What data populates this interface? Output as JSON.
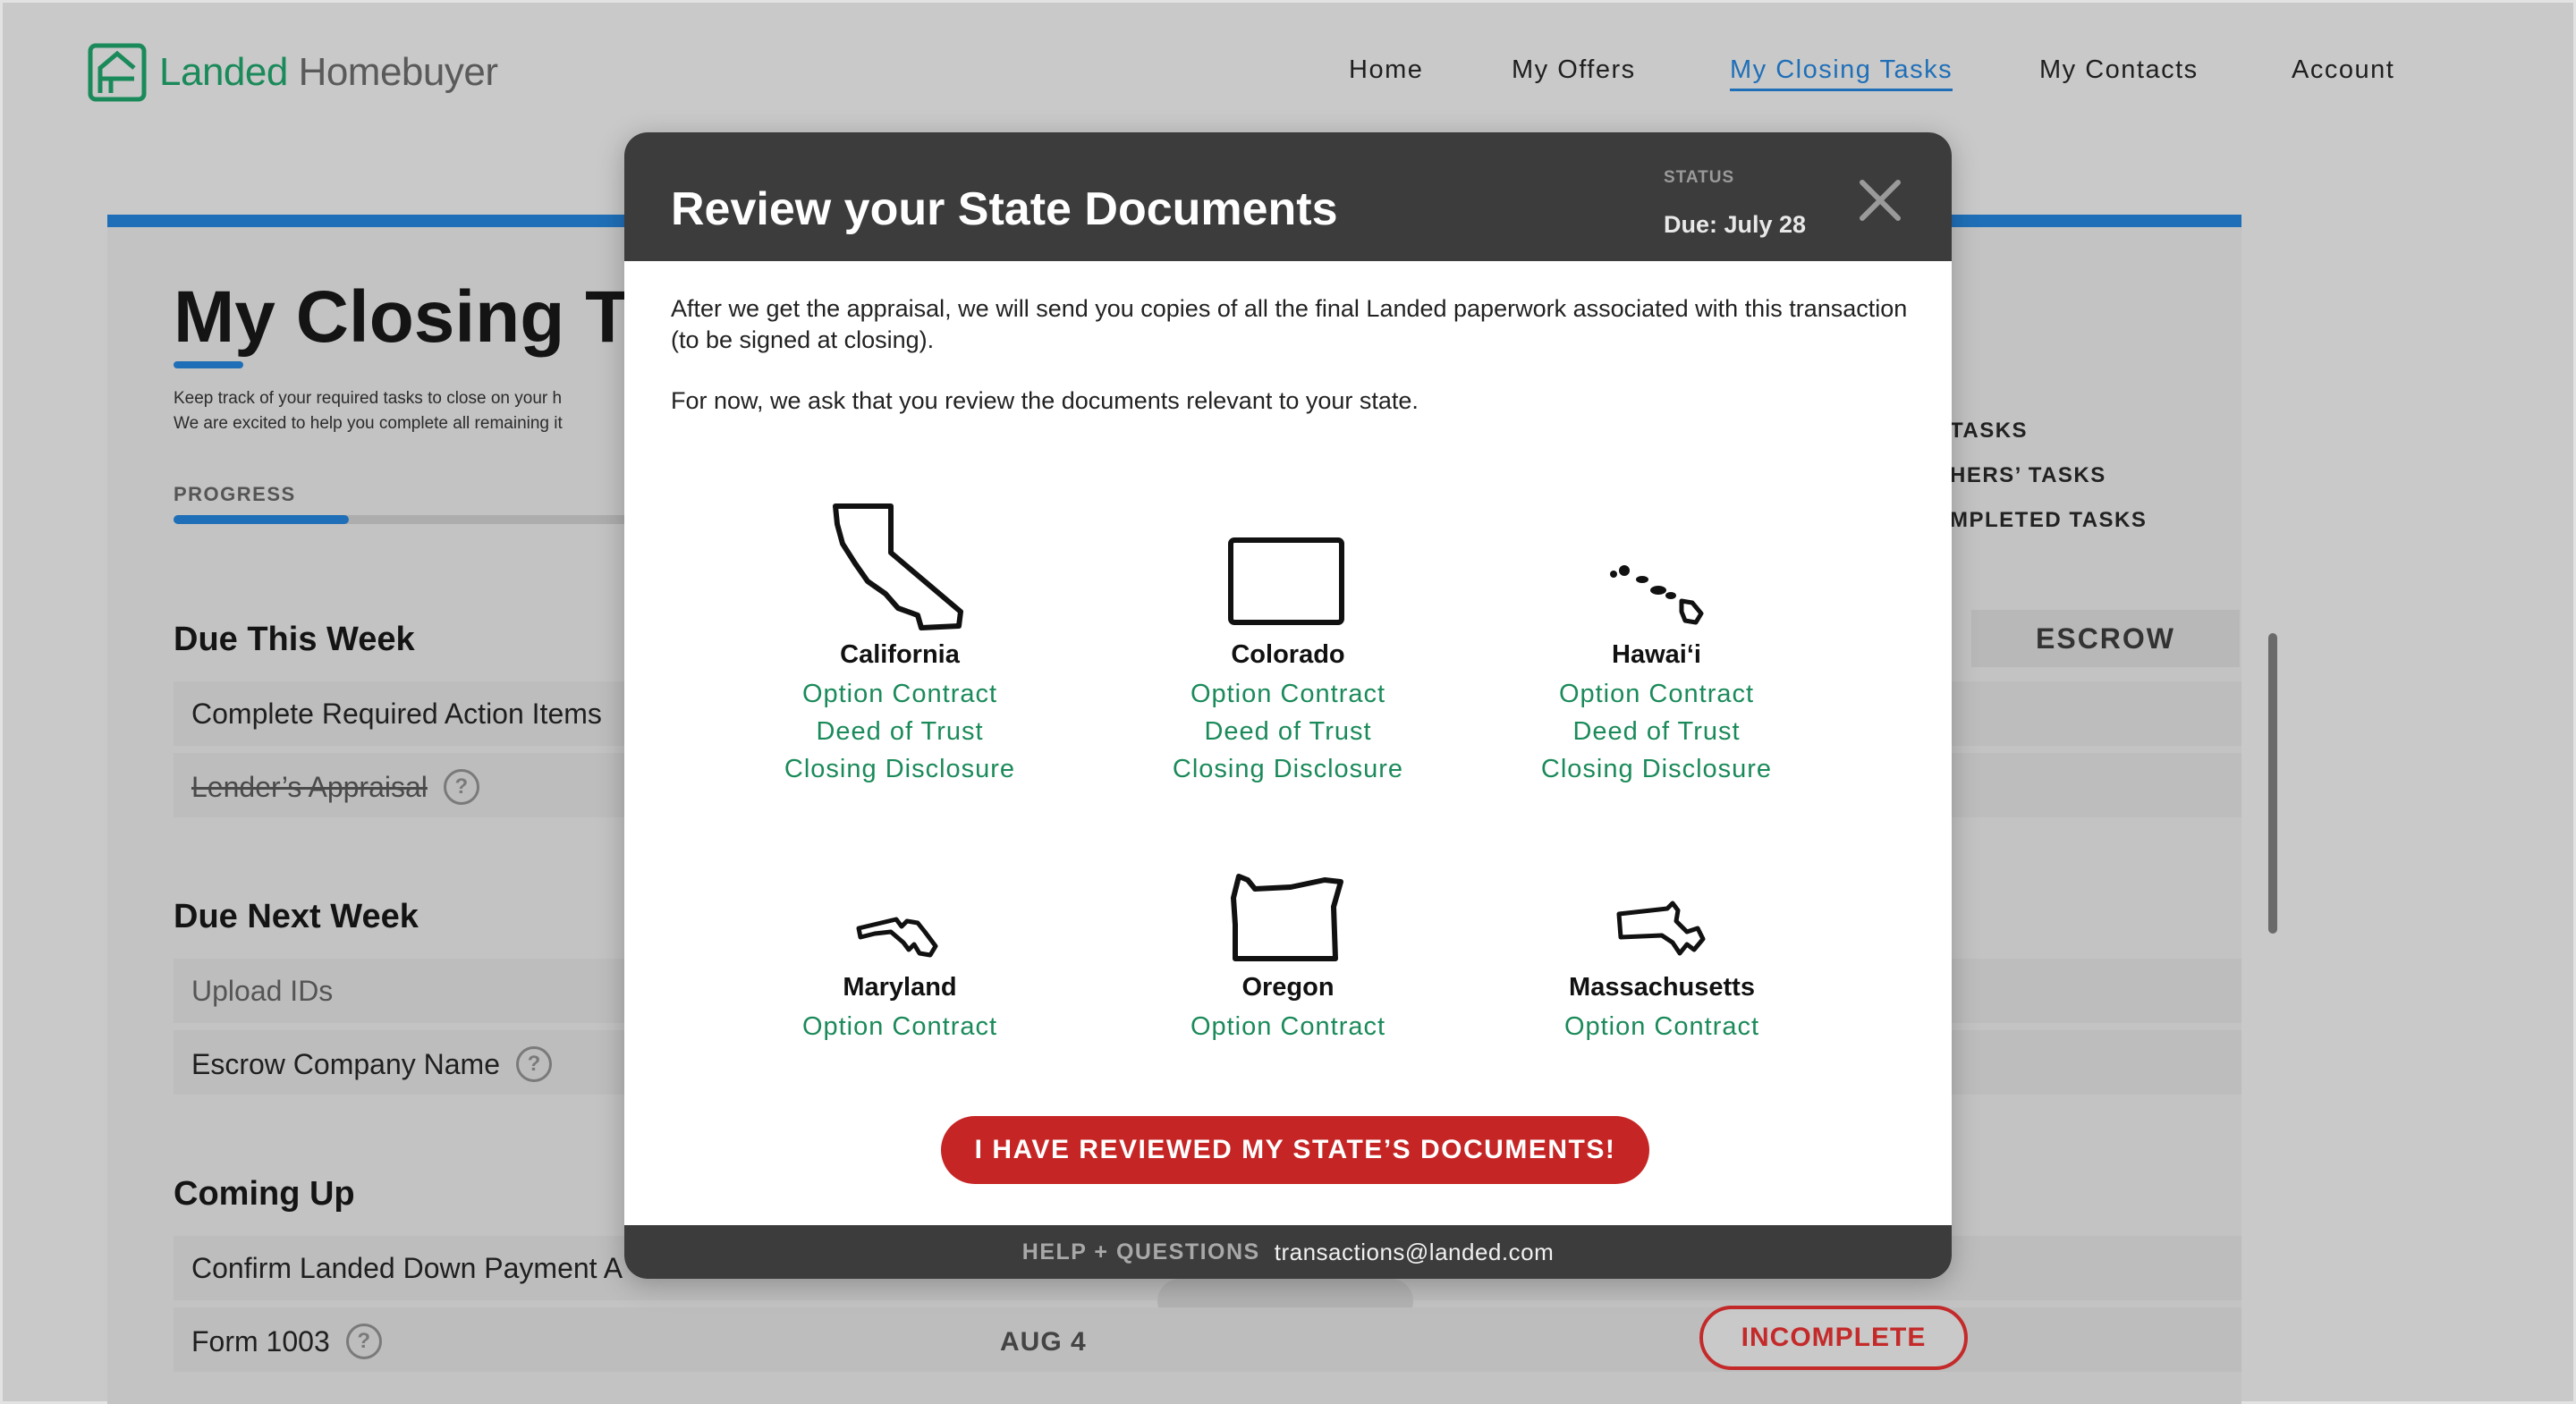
{
  "app": {
    "logo_name": "Landed",
    "logo_suffix": "Homebuyer",
    "brand_green": "#1b8a5a",
    "brand_blue": "#1f6fb8"
  },
  "nav": {
    "items": [
      {
        "label": "Home",
        "active": false
      },
      {
        "label": "My Offers",
        "active": false
      },
      {
        "label": "My Closing Tasks",
        "active": true
      },
      {
        "label": "My Contacts",
        "active": false
      },
      {
        "label": "Account",
        "active": false
      }
    ]
  },
  "page": {
    "title": "My Closing Ta",
    "subtitle_line1": "Keep track of your required tasks to close on your h",
    "subtitle_line2": "We are excited to help you complete all remaining it",
    "progress_label": "PROGRESS",
    "progress_fraction": 0.35
  },
  "filters": {
    "items": [
      "TASKS",
      "HERS’ TASKS",
      "MPLETED TASKS"
    ]
  },
  "column_header": "ESCROW",
  "sections": {
    "due_this_week": {
      "title": "Due This Week",
      "rows": [
        {
          "label": "Complete Required Action Items"
        },
        {
          "label": "Lender’s Appraisal"
        }
      ]
    },
    "due_next_week": {
      "title": "Due Next Week",
      "rows": [
        {
          "label": "Upload IDs"
        },
        {
          "label": "Escrow Company Name"
        }
      ]
    },
    "coming_up": {
      "title": "Coming Up",
      "rows": [
        {
          "label": "Confirm Landed Down Payment A"
        },
        {
          "label": "Form 1003",
          "date": "AUG 4",
          "status": "INCOMPLETE"
        }
      ]
    }
  },
  "modal": {
    "title": "Review your State Documents",
    "status_label": "STATUS",
    "status_value": "Due: July 28",
    "body_p1": "After we get the appraisal, we will send you copies of all the final Landed paperwork associated with this transaction (to be signed at closing).",
    "body_p2": "For now, we ask that you review the documents relevant to your state.",
    "states": [
      {
        "name": "California",
        "icon": "california-outline-icon",
        "docs": [
          "Option Contract",
          "Deed of Trust",
          "Closing Disclosure"
        ]
      },
      {
        "name": "Colorado",
        "icon": "colorado-outline-icon",
        "docs": [
          "Option Contract",
          "Deed of Trust",
          "Closing Disclosure"
        ]
      },
      {
        "name": "Hawai‘i",
        "icon": "hawaii-outline-icon",
        "docs": [
          "Option Contract",
          "Deed of Trust",
          "Closing Disclosure"
        ]
      },
      {
        "name": "Maryland",
        "icon": "maryland-outline-icon",
        "docs": [
          "Option Contract"
        ]
      },
      {
        "name": "Oregon",
        "icon": "oregon-outline-icon",
        "docs": [
          "Option Contract"
        ]
      },
      {
        "name": "Massachusetts",
        "icon": "massachusetts-outline-icon",
        "docs": [
          "Option Contract"
        ]
      }
    ],
    "confirm_button": "I HAVE REVIEWED MY STATE’S DOCUMENTS!",
    "footer_label": "HELP + QUESTIONS",
    "footer_email": "transactions@landed.com",
    "close_icon": "close-icon",
    "accent_red": "#c62525"
  }
}
